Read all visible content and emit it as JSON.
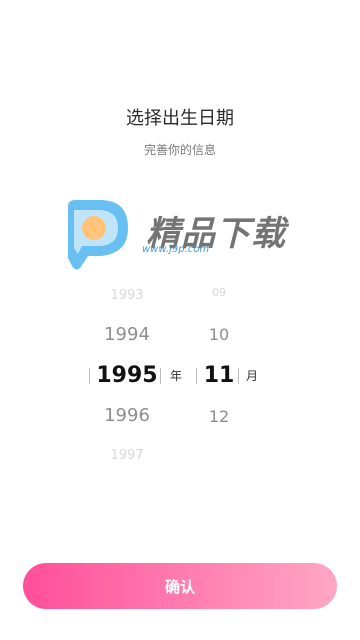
{
  "header": {
    "title": "选择出生日期",
    "subtitle": "完善你的信息"
  },
  "watermark": {
    "brand_text": "精品下载",
    "url_text": "www.j9p.com",
    "icon": "p-logo-icon"
  },
  "picker": {
    "year": {
      "items": [
        "1993",
        "1994",
        "1995",
        "1996",
        "1997"
      ],
      "selected": "1995",
      "unit": "年"
    },
    "month": {
      "items": [
        "09",
        "10",
        "11",
        "12"
      ],
      "selected": "11",
      "unit": "月"
    }
  },
  "footer": {
    "confirm_label": "确认"
  },
  "colors": {
    "button_gradient_start": "#ff4f9a",
    "button_gradient_end": "#ffa7c4",
    "watermark_blue": "#3aa0e8",
    "watermark_orange": "#ffc47a"
  }
}
